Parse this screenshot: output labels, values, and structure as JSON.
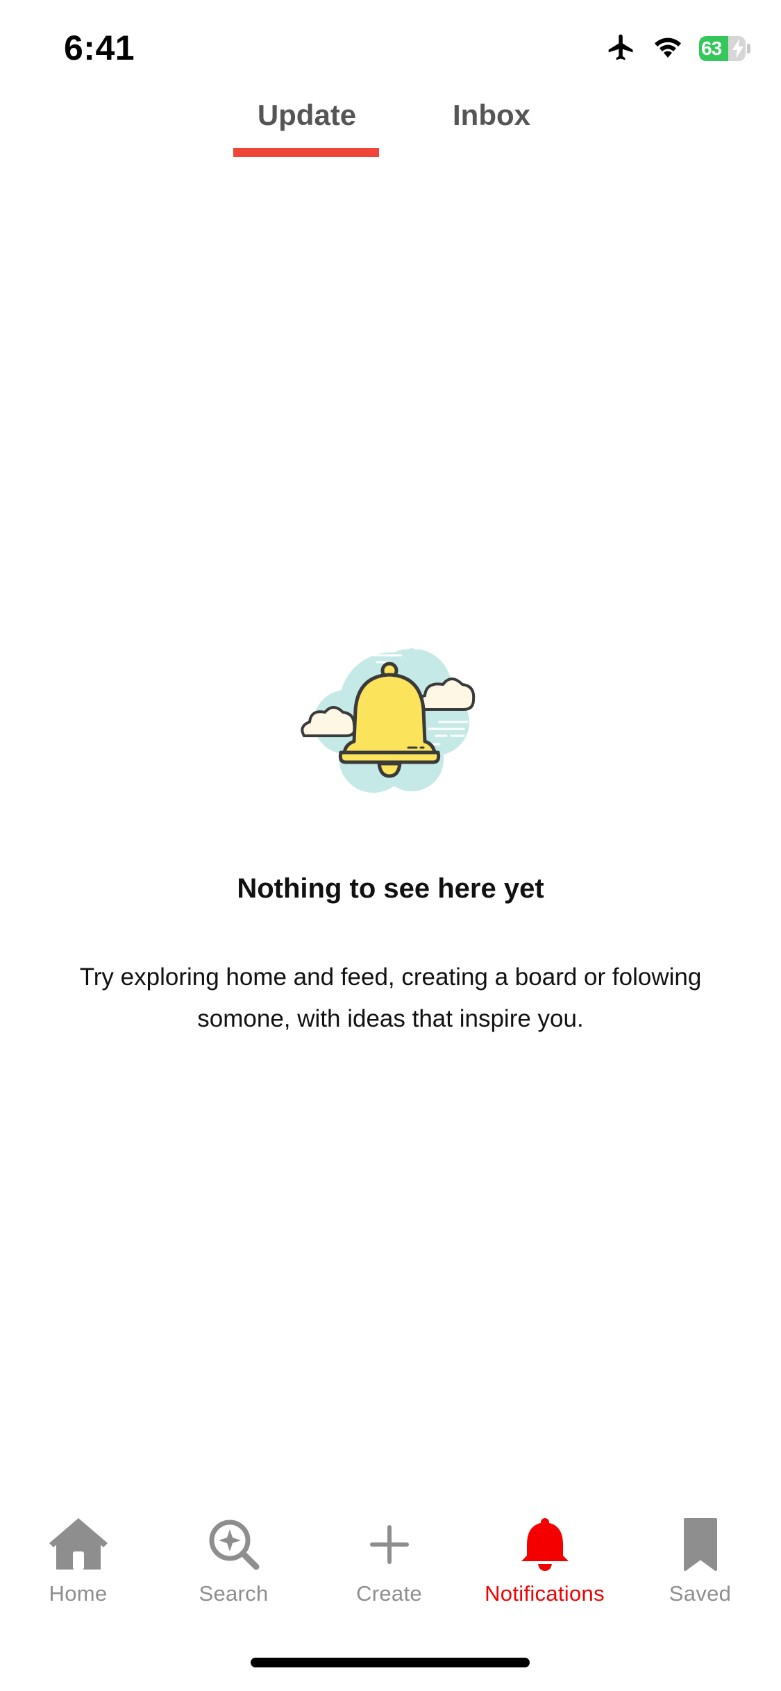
{
  "status_bar": {
    "time": "6:41",
    "battery_level": "63",
    "battery_fraction": 0.63,
    "battery_color": "#34c759",
    "icons": [
      "airplane-icon",
      "wifi-icon",
      "battery-charging-icon"
    ]
  },
  "tabs": {
    "items": [
      {
        "label": "Update",
        "active": true
      },
      {
        "label": "Inbox",
        "active": false
      }
    ],
    "accent_color": "#f0463a"
  },
  "empty_state": {
    "illustration": "bell-with-clouds-illustration",
    "title": "Nothing to see here yet",
    "body": "Try exploring home and feed, creating a board or folowing somone, with ideas that inspire you."
  },
  "bottom_nav": {
    "items": [
      {
        "label": "Home",
        "icon": "home-icon",
        "active": false
      },
      {
        "label": "Search",
        "icon": "search-icon",
        "active": false
      },
      {
        "label": "Create",
        "icon": "plus-icon",
        "active": false
      },
      {
        "label": "Notifications",
        "icon": "bell-icon",
        "active": true
      },
      {
        "label": "Saved",
        "icon": "bookmark-icon",
        "active": false
      }
    ],
    "active_color": "#f40000",
    "inactive_color": "#8e8e8e"
  }
}
